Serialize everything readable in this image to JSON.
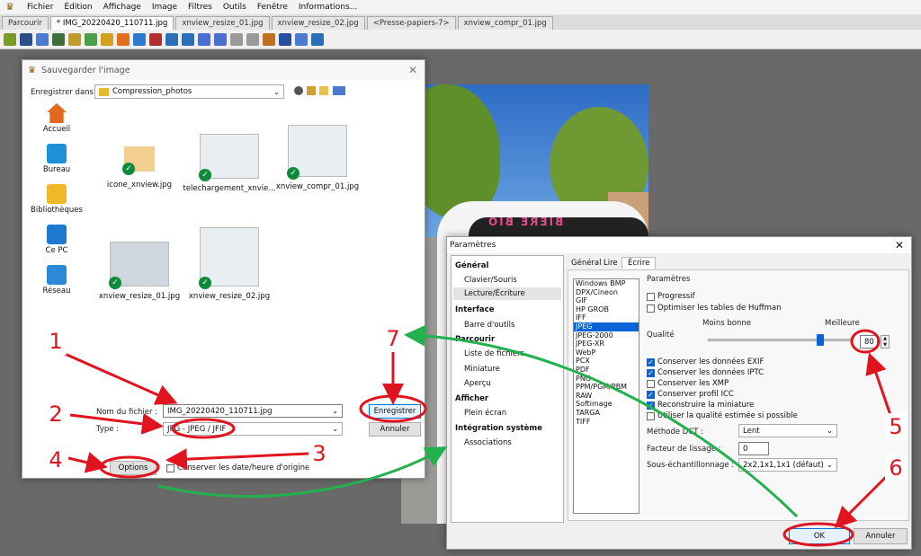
{
  "app": {
    "menu": [
      "Fichier",
      "Édition",
      "Affichage",
      "Image",
      "Filtres",
      "Outils",
      "Fenêtre",
      "Informations..."
    ],
    "tabs": [
      "Parcourir",
      "* IMG_20220420_110711.jpg",
      "xnview_resize_01.jpg",
      "xnview_resize_02.jpg",
      "<Presse-papiers-7>",
      "xnview_compr_01.jpg"
    ]
  },
  "save_dialog": {
    "title": "Sauvegarder l'image",
    "save_in_label": "Enregistrer dans :",
    "folder": "Compression_photos",
    "places": [
      "Accueil",
      "Bureau",
      "Bibliothèques",
      "Ce PC",
      "Réseau"
    ],
    "files": [
      "icone_xnview.jpg",
      "telechargement_xnvie...",
      "xnview_compr_01.jpg",
      "xnview_resize_01.jpg",
      "xnview_resize_02.jpg"
    ],
    "filename_label": "Nom du fichier :",
    "filename": "IMG_20220420_110711.jpg",
    "type_label": "Type :",
    "type": "JPG - JPEG / JFIF",
    "save_button": "Enregistrer",
    "cancel_button": "Annuler",
    "options_button": "Options",
    "keep_date_label": "Conserver les date/heure d'origine"
  },
  "viewer": {
    "van_text": "BIERE BIO"
  },
  "params_dialog": {
    "title": "Paramètres",
    "nav": [
      {
        "label": "Général",
        "header": true
      },
      {
        "label": "Clavier/Souris",
        "header": false
      },
      {
        "label": "Lecture/Écriture",
        "header": false
      },
      {
        "label": "Interface",
        "header": true
      },
      {
        "label": "Barre d'outils",
        "header": false
      },
      {
        "label": "Parcourir",
        "header": true
      },
      {
        "label": "Liste de fichiers",
        "header": false
      },
      {
        "label": "Miniature",
        "header": false
      },
      {
        "label": "Aperçu",
        "header": false
      },
      {
        "label": "Afficher",
        "header": true
      },
      {
        "label": "Plein écran",
        "header": false
      },
      {
        "label": "Intégration système",
        "header": true
      },
      {
        "label": "Associations",
        "header": false
      }
    ],
    "tabs": [
      "Général",
      "Lire",
      "Écrire"
    ],
    "formats": [
      "Windows BMP",
      "DPX/Cineon",
      "GIF",
      "HP GROB",
      "IFF",
      "JPEG",
      "JPEG-2000",
      "JPEG-XR",
      "WebP",
      "PCX",
      "PDF",
      "PNG",
      "PPM/PGM/PBM",
      "RAW",
      "Softimage",
      "TARGA",
      "TIFF"
    ],
    "selected_format": "JPEG",
    "section": "Paramètres",
    "progressive": "Progressif",
    "huffman": "Optimiser les tables de Huffman",
    "quality_low": "Moins bonne",
    "quality_high": "Meilleure",
    "quality_label": "Qualité",
    "quality": "80",
    "quality_fraction": 0.8,
    "checks": [
      {
        "label": "Conserver les données EXIF",
        "on": true
      },
      {
        "label": "Conserver les données IPTC",
        "on": true
      },
      {
        "label": "Conserver les XMP",
        "on": false
      },
      {
        "label": "Conserver profil ICC",
        "on": true
      },
      {
        "label": "Reconstruire la miniature",
        "on": true
      },
      {
        "label": "Utiliser la qualité estimée si possible",
        "on": false
      }
    ],
    "dct_label": "Méthode DCT :",
    "dct": "Lent",
    "smoothing_label": "Facteur de lissage :",
    "smoothing": "0",
    "subsampling_label": "Sous-échantillonnage :",
    "subsampling": "2x2,1x1,1x1 (défaut)",
    "ok_button": "OK",
    "cancel_button": "Annuler"
  },
  "annotations": [
    "1",
    "2",
    "3",
    "4",
    "5",
    "6",
    "7"
  ],
  "colors": {
    "accent": "#0a64d6",
    "annotation_red": "#e0141e",
    "annotation_green": "#22b14c"
  }
}
